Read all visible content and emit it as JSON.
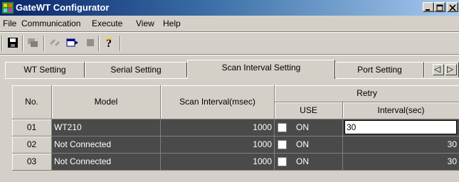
{
  "window": {
    "title": "GateWT Configurator",
    "controls": {
      "minimize": "minimize",
      "maximize": "maximize",
      "close": "close"
    }
  },
  "menu": [
    "File",
    "Communication",
    "Execute",
    "View",
    "Help"
  ],
  "toolbar": {
    "icons": [
      "save-icon",
      "transfer-icon",
      "connect-icon",
      "run-icon",
      "stop-icon",
      "help-icon"
    ]
  },
  "tabs": {
    "items": [
      "WT Setting",
      "Serial Setting",
      "Scan Interval Setting",
      "Port Setting"
    ],
    "active": "Scan Interval Setting",
    "scroll_left": "◁",
    "scroll_right": "▷"
  },
  "grid": {
    "headers": {
      "no": "No.",
      "model": "Model",
      "scan_interval": "Scan Interval(msec)",
      "retry": "Retry",
      "use": "USE",
      "interval": "Interval(sec)"
    },
    "rows": [
      {
        "no": "01",
        "model": "WT210",
        "scan": "1000",
        "use": "ON",
        "interval": "30",
        "editing": true
      },
      {
        "no": "02",
        "model": "Not Connected",
        "scan": "1000",
        "use": "ON",
        "interval": "30",
        "editing": false
      },
      {
        "no": "03",
        "model": "Not Connected",
        "scan": "1000",
        "use": "ON",
        "interval": "30",
        "editing": false
      }
    ]
  },
  "colors": {
    "title_start": "#0a246a",
    "title_end": "#a6caf0",
    "cell_dark": "#4a4a4a",
    "face": "#d4d0c8"
  }
}
